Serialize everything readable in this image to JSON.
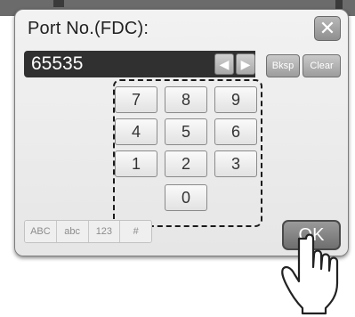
{
  "dialog": {
    "title": "Port No.(FDC):",
    "close_symbol": "✕",
    "value": "65535"
  },
  "cursor_buttons": {
    "left_symbol": "◀",
    "right_symbol": "▶"
  },
  "edit_buttons": {
    "backspace_label": "Bksp",
    "clear_label": "Clear"
  },
  "keypad": {
    "keys": [
      "7",
      "8",
      "9",
      "4",
      "5",
      "6",
      "1",
      "2",
      "3",
      "0"
    ]
  },
  "modes": [
    "ABC",
    "abc",
    "123",
    "#"
  ],
  "ok_label": "OK",
  "icons": {
    "close": "close-icon",
    "left_arrow": "left-arrow-icon",
    "right_arrow": "right-arrow-icon",
    "pointer": "pointing-hand-icon"
  }
}
